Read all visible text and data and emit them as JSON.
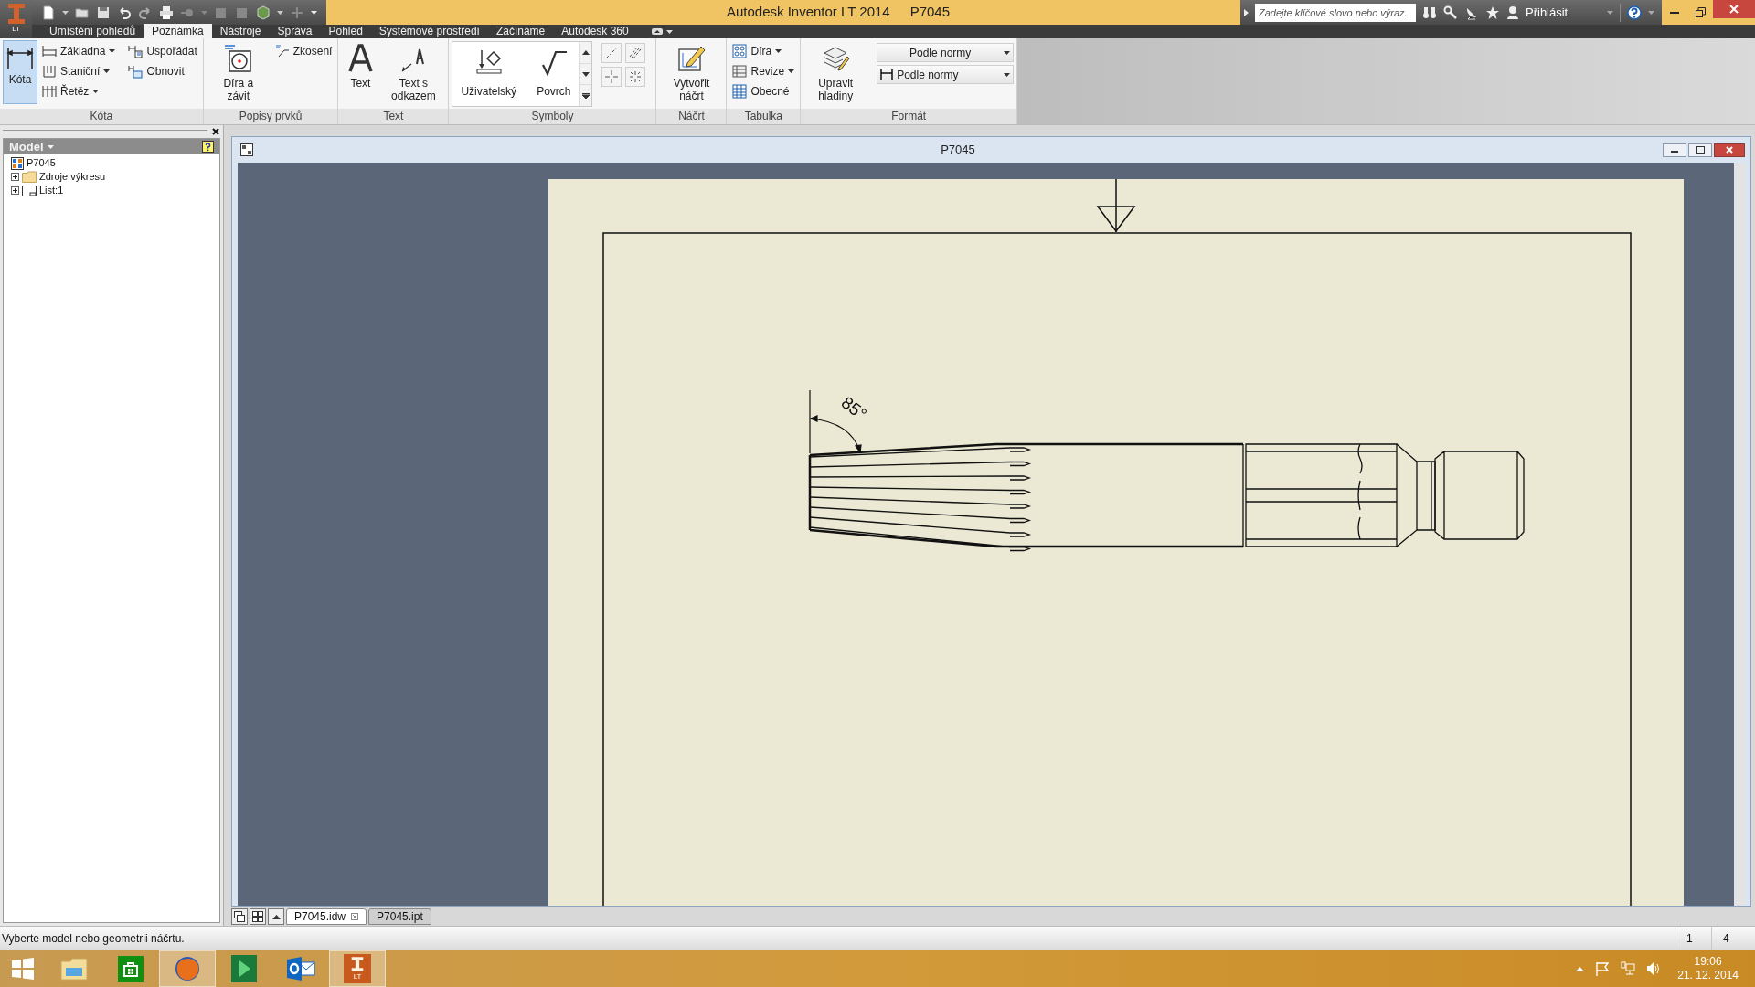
{
  "app_button": {
    "badge": "LT"
  },
  "title_bar": {
    "app_title": "Autodesk Inventor LT 2014",
    "document": "P7045",
    "search": {
      "placeholder": "Zadejte klíčové slovo nebo výraz."
    },
    "sign_in": "Přihlásit"
  },
  "ribbon_tabs": [
    {
      "label": "Umístění pohledů",
      "selected": false
    },
    {
      "label": "Poznámka",
      "selected": true
    },
    {
      "label": "Nástroje",
      "selected": false
    },
    {
      "label": "Správa",
      "selected": false
    },
    {
      "label": "Pohled",
      "selected": false
    },
    {
      "label": "Systémové prostředí",
      "selected": false
    },
    {
      "label": "Začínáme",
      "selected": false
    },
    {
      "label": "Autodesk 360",
      "selected": false
    }
  ],
  "ribbon_panels": [
    {
      "title": "Kóta",
      "items": [
        {
          "kind": "large",
          "label": "Kóta",
          "active": true
        },
        {
          "kind": "small",
          "label": "Základna",
          "active": false,
          "dropdown": true
        },
        {
          "kind": "small",
          "label": "Staniční",
          "active": false,
          "dropdown": true
        },
        {
          "kind": "small",
          "label": "Řetěz",
          "active": false,
          "dropdown": true
        },
        {
          "kind": "small",
          "label": "Uspořádat",
          "active": false,
          "dropdown": false
        },
        {
          "kind": "small",
          "label": "Obnovit",
          "active": false,
          "dropdown": false
        }
      ]
    },
    {
      "title": "Popisy prvků",
      "items": [
        {
          "kind": "large",
          "label": "Díra a závit",
          "active": false
        },
        {
          "kind": "small",
          "label": "Zkosení",
          "active": false,
          "dropdown": false
        }
      ]
    },
    {
      "title": "Text",
      "items": [
        {
          "kind": "large",
          "label": "Text",
          "active": false
        },
        {
          "kind": "large",
          "label": "Text s odkazem",
          "active": false
        }
      ]
    },
    {
      "title": "Symboly",
      "items": [
        {
          "kind": "gallery",
          "label": "Uživatelský",
          "active": false
        },
        {
          "kind": "gallery",
          "label": "Povrch",
          "active": false
        },
        {
          "kind": "icon",
          "active": false
        },
        {
          "kind": "icon",
          "active": false
        },
        {
          "kind": "icon",
          "active": false
        },
        {
          "kind": "icon",
          "active": false
        }
      ]
    },
    {
      "title": "Náčrt",
      "items": [
        {
          "kind": "large",
          "label": "Vytvořit náčrt",
          "active": false
        }
      ]
    },
    {
      "title": "Tabulka",
      "items": [
        {
          "kind": "small",
          "label": "Díra",
          "active": false,
          "dropdown": true
        },
        {
          "kind": "small",
          "label": "Revize",
          "active": false,
          "dropdown": true
        },
        {
          "kind": "small",
          "label": "Obecné",
          "active": false,
          "dropdown": false
        }
      ]
    },
    {
      "title": "Formát",
      "items": [
        {
          "kind": "large",
          "label": "Upravit hladiny",
          "active": false
        },
        {
          "kind": "combo",
          "value": "Podle normy",
          "active": false,
          "dropdown": true
        },
        {
          "kind": "combo",
          "value": "Podle normy",
          "active": false,
          "dropdown": true
        }
      ]
    }
  ],
  "browser": {
    "title": "Model",
    "tree": [
      {
        "label": "P7045",
        "kind": "drawing",
        "expanded": true,
        "children": [
          {
            "label": "Zdroje výkresu",
            "kind": "folder",
            "expanded": false
          },
          {
            "label": "List:1",
            "kind": "sheet",
            "expanded": false
          }
        ]
      }
    ]
  },
  "document_window": {
    "title": "P7045",
    "drawing": {
      "dimension": "85°"
    }
  },
  "document_tabs": [
    {
      "label": "P7045.idw",
      "selected": true
    },
    {
      "label": "P7045.ipt",
      "selected": false
    }
  ],
  "status_bar": {
    "message": "Vyberte model nebo geometrii náčrtu.",
    "fields": [
      "1",
      "4"
    ]
  },
  "taskbar": {
    "apps": [
      {
        "kind": "start",
        "active": false
      },
      {
        "kind": "explorer",
        "active": false
      },
      {
        "kind": "store",
        "active": false
      },
      {
        "kind": "firefox",
        "active": true
      },
      {
        "kind": "project",
        "active": false
      },
      {
        "kind": "outlook",
        "active": false
      },
      {
        "kind": "inventor",
        "active": true,
        "badge": "LT"
      }
    ],
    "time": "19:06",
    "date": "21. 12. 2014"
  }
}
